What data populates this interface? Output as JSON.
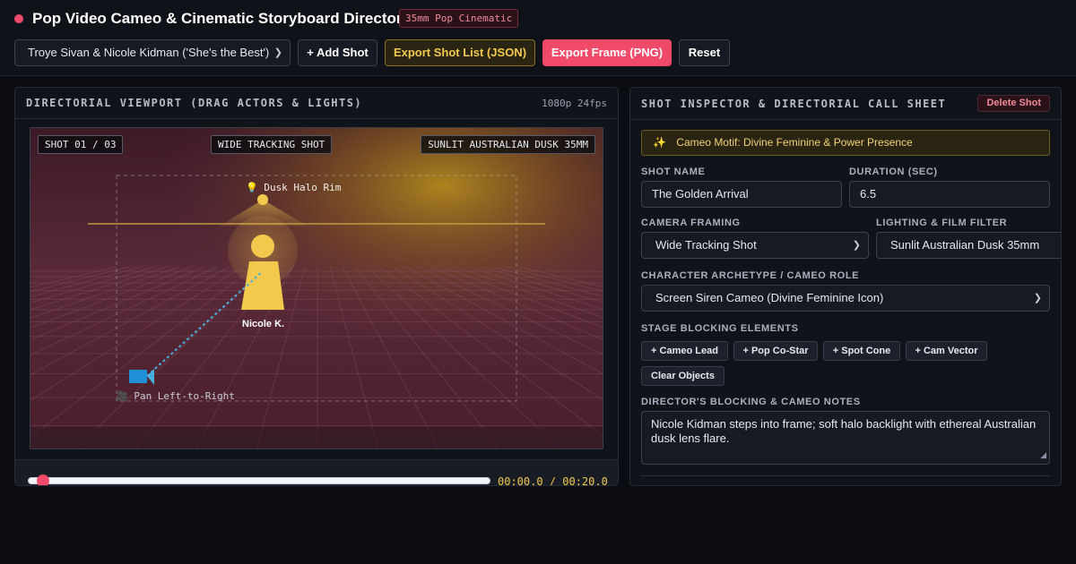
{
  "header": {
    "title": "Pop Video Cameo & Cinematic Storyboard Director",
    "style_badge": "35mm Pop Cinematic",
    "preset": "Troye Sivan & Nicole Kidman ('She's the Best')",
    "add_shot": "+ Add Shot",
    "export_json": "Export Shot List (JSON)",
    "export_png": "Export Frame (PNG)",
    "reset": "Reset",
    "status_dot_color": "#f04a6a",
    "chevron_icon": "chevron-down-icon"
  },
  "viewport": {
    "title": "DIRECTORIAL VIEWPORT (DRAG ACTORS & LIGHTS)",
    "spec": "1080p 24fps",
    "shot_tag": "SHOT 01 / 03",
    "framing_tag": "WIDE TRACKING SHOT",
    "light_tag": "SUNLIT AUSTRALIAN DUSK 35MM",
    "light_label": "💡 Dusk Halo Rim",
    "actor_label": "Nicole K.",
    "camera_label": "🎥 Pan Left-to-Right",
    "timecode": "00:00.0 / 00:20.0",
    "playhead_fraction": 0.0,
    "colors": {
      "stage": "#5a2a3a",
      "actor": "#f2c94c",
      "camera": "#1f8fd6",
      "accent": "#f04a6a"
    }
  },
  "inspector": {
    "title": "SHOT INSPECTOR & DIRECTORIAL CALL SHEET",
    "delete_shot": "Delete Shot",
    "motif_icon": "✨",
    "motif": "Cameo Motif: Divine Feminine & Power Presence",
    "shot_name_label": "SHOT NAME",
    "shot_name": "The Golden Arrival",
    "duration_label": "DURATION (SEC)",
    "duration": "6.5",
    "framing_label": "CAMERA FRAMING",
    "framing": "Wide Tracking Shot",
    "filter_label": "LIGHTING & FILM FILTER",
    "filter": "Sunlit Australian Dusk 35mm",
    "archetype_label": "CHARACTER ARCHETYPE / CAMEO ROLE",
    "archetype": "Screen Siren Cameo (Divine Feminine Icon)",
    "blocking_label": "STAGE BLOCKING ELEMENTS",
    "chips": {
      "cameo_lead": "+ Cameo Lead",
      "pop_costar": "+ Pop Co-Star",
      "spot_cone": "+ Spot Cone",
      "cam_vector": "+ Cam Vector",
      "clear": "Clear Objects"
    },
    "notes_label": "DIRECTOR'S BLOCKING & CAMEO NOTES",
    "notes": "Nicole Kidman steps into frame; soft halo backlight with ethereal Australian dusk lens flare."
  }
}
